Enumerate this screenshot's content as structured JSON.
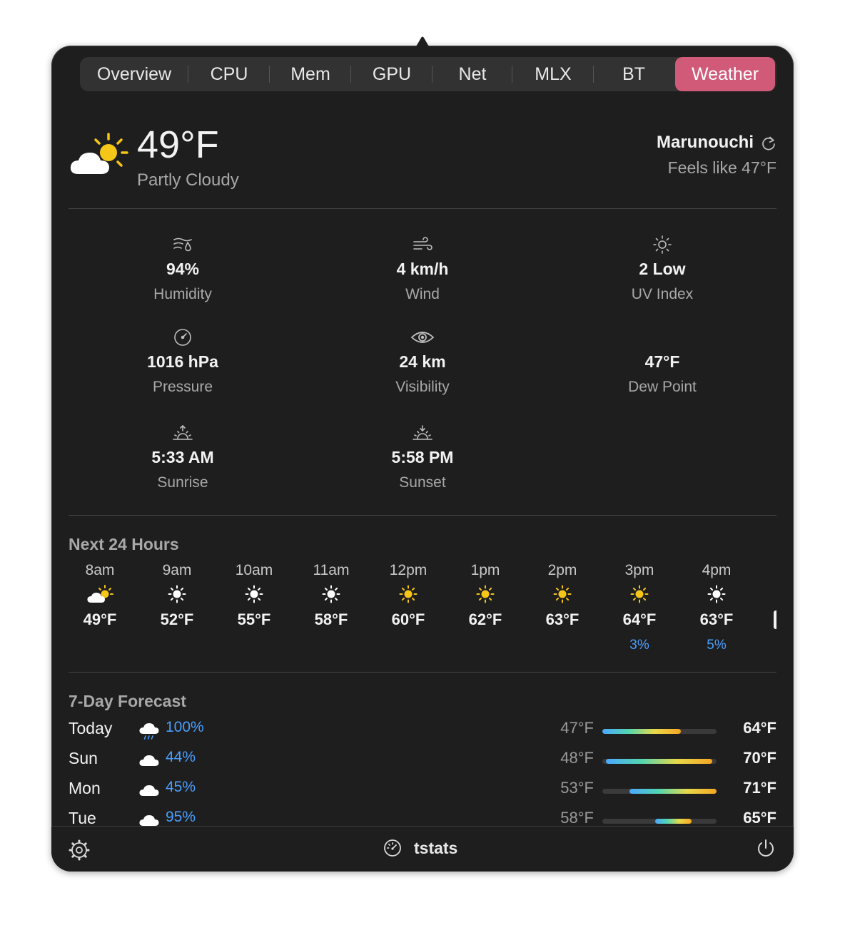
{
  "tabs": [
    {
      "label": "Overview"
    },
    {
      "label": "CPU"
    },
    {
      "label": "Mem"
    },
    {
      "label": "GPU"
    },
    {
      "label": "Net"
    },
    {
      "label": "MLX"
    },
    {
      "label": "BT"
    },
    {
      "label": "Weather",
      "active": true
    }
  ],
  "current": {
    "icon": "partly-cloudy-icon",
    "temperature": "49°F",
    "condition": "Partly Cloudy",
    "location": "Marunouchi",
    "feels_like": "Feels like 47°F"
  },
  "stats": [
    {
      "icon": "humidity-icon",
      "value": "94%",
      "label": "Humidity"
    },
    {
      "icon": "wind-icon",
      "value": "4 km/h",
      "label": "Wind"
    },
    {
      "icon": "sun-icon",
      "value": "2 Low",
      "label": "UV Index"
    },
    {
      "icon": "gauge-icon",
      "value": "1016 hPa",
      "label": "Pressure"
    },
    {
      "icon": "eye-icon",
      "value": "24 km",
      "label": "Visibility"
    },
    {
      "icon": "",
      "value": "47°F",
      "label": "Dew Point"
    },
    {
      "icon": "sunrise-icon",
      "value": "5:33 AM",
      "label": "Sunrise"
    },
    {
      "icon": "sunset-icon",
      "value": "5:58 PM",
      "label": "Sunset"
    }
  ],
  "hourly": {
    "title": "Next 24 Hours",
    "items": [
      {
        "time": "8am",
        "icon": "partly-cloudy-icon",
        "temp": "49°F",
        "precip": ""
      },
      {
        "time": "9am",
        "icon": "sun-white-icon",
        "temp": "52°F",
        "precip": ""
      },
      {
        "time": "10am",
        "icon": "sun-white-icon",
        "temp": "55°F",
        "precip": ""
      },
      {
        "time": "11am",
        "icon": "sun-white-icon",
        "temp": "58°F",
        "precip": ""
      },
      {
        "time": "12pm",
        "icon": "sun-yellow-icon",
        "temp": "60°F",
        "precip": ""
      },
      {
        "time": "1pm",
        "icon": "sun-yellow-icon",
        "temp": "62°F",
        "precip": ""
      },
      {
        "time": "2pm",
        "icon": "sun-yellow-icon",
        "temp": "63°F",
        "precip": ""
      },
      {
        "time": "3pm",
        "icon": "sun-yellow-icon",
        "temp": "64°F",
        "precip": "3%"
      },
      {
        "time": "4pm",
        "icon": "sun-white-icon",
        "temp": "63°F",
        "precip": "5%"
      }
    ]
  },
  "daily": {
    "title": "7-Day Forecast",
    "items": [
      {
        "day": "Today",
        "icon": "rain-cloud-icon",
        "precip": "100%",
        "low": "47°F",
        "high": "64°F",
        "range": [
          0,
          0.69
        ]
      },
      {
        "day": "Sun",
        "icon": "cloud-icon",
        "precip": "44%",
        "low": "48°F",
        "high": "70°F",
        "range": [
          0.03,
          0.96
        ]
      },
      {
        "day": "Mon",
        "icon": "cloud-icon",
        "precip": "45%",
        "low": "53°F",
        "high": "71°F",
        "range": [
          0.24,
          1.0
        ]
      },
      {
        "day": "Tue",
        "icon": "cloud-icon",
        "precip": "95%",
        "low": "58°F",
        "high": "65°F",
        "range": [
          0.46,
          0.78
        ]
      }
    ]
  },
  "footer": {
    "brand": "tstats",
    "settings_icon": "gear-icon",
    "brand_icon": "speedometer-icon",
    "power_icon": "power-icon"
  },
  "colors": {
    "accent": "#d05a78",
    "background": "#1e1e1e",
    "precip": "#4a9eff",
    "sun": "#f5c518"
  }
}
